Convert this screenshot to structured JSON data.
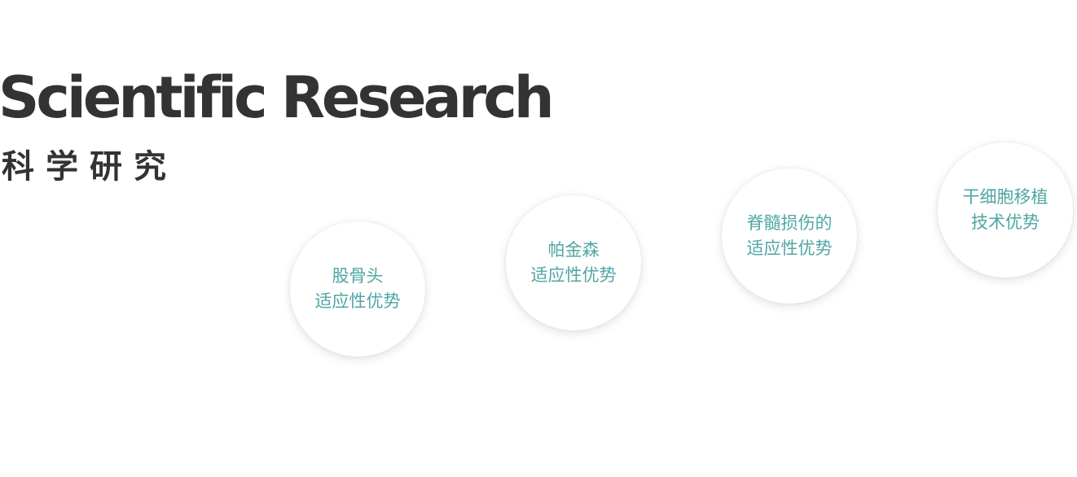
{
  "heading": {
    "title_en": "Scientific Research",
    "title_cn": "科学研究"
  },
  "topics": [
    {
      "line1": "股骨头",
      "line2": "适应性优势"
    },
    {
      "line1": "帕金森",
      "line2": "适应性优势"
    },
    {
      "line1": "脊髓损伤的",
      "line2": "适应性优势"
    },
    {
      "line1": "干细胞移植",
      "line2": "技术优势"
    }
  ],
  "colors": {
    "heading": "#333333",
    "accent_text": "#4fa6a4",
    "circle_bg": "#ffffff",
    "page_bg": "#ffffff"
  }
}
